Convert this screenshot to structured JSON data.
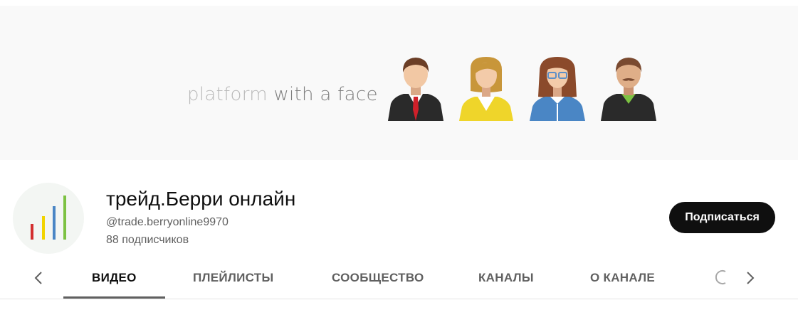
{
  "banner": {
    "tagline_light": "platform",
    "tagline_dark": "with a face"
  },
  "channel": {
    "title": "трейд.Берри онлайн",
    "handle": "@trade.berryonline9970",
    "subscribers": "88 подписчиков",
    "subscribe_label": "Подписаться"
  },
  "tabs": [
    {
      "label": "ВИДЕО",
      "active": true
    },
    {
      "label": "ПЛЕЙЛИСТЫ",
      "active": false
    },
    {
      "label": "СООБЩЕСТВО",
      "active": false
    },
    {
      "label": "КАНАЛЫ",
      "active": false
    },
    {
      "label": "О КАНАЛЕ",
      "active": false
    }
  ],
  "icons": {
    "prev": "chevron-left-icon",
    "next": "chevron-right-icon",
    "search": "search-icon"
  },
  "colors": {
    "accent": "#0f0f0f",
    "banner_bg": "#f9f9f9",
    "logo_bars": [
      "#d32f2f",
      "#f2d400",
      "#4a86c5",
      "#7cc242"
    ]
  }
}
